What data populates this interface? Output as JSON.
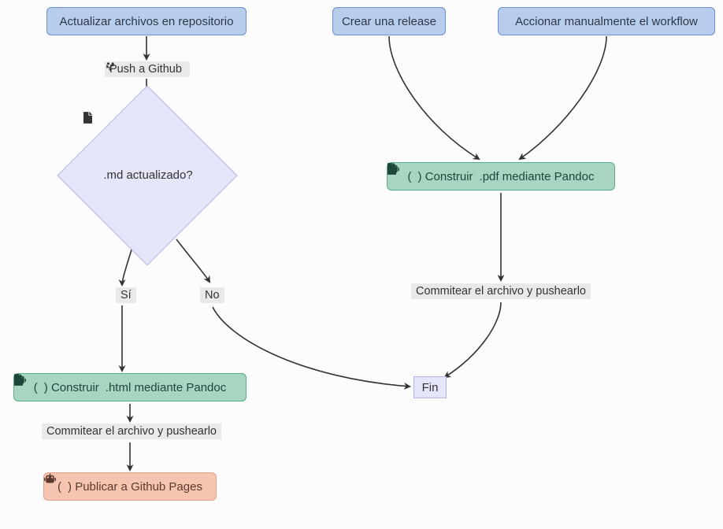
{
  "nodes": {
    "update": "Actualizar archivos en repositorio",
    "release": "Crear una release",
    "manual": "Accionar manualmente el workflow",
    "decision_pre": ".md actualizado?",
    "build_html_pre": "(",
    "build_html_post": ") Construir ",
    "build_html_ext": ".html mediante Pandoc",
    "build_pdf_pre": "(",
    "build_pdf_post": ") Construir ",
    "build_pdf_ext": ".pdf mediante Pandoc",
    "publish_pre": "(",
    "publish_post": ") Publicar a Github Pages",
    "fin": "Fin"
  },
  "edges": {
    "push_pre": "Push a Github ",
    "si": "Sí",
    "no": "No",
    "commit1": "Commitear el archivo y pushearlo",
    "commit2": "Commitear el archivo y pushearlo"
  },
  "icons": {
    "file": "file-icon",
    "code": "file-code-icon",
    "pdf": "file-pdf-icon",
    "robot": "robot-icon",
    "branch": "code-branch-icon"
  }
}
